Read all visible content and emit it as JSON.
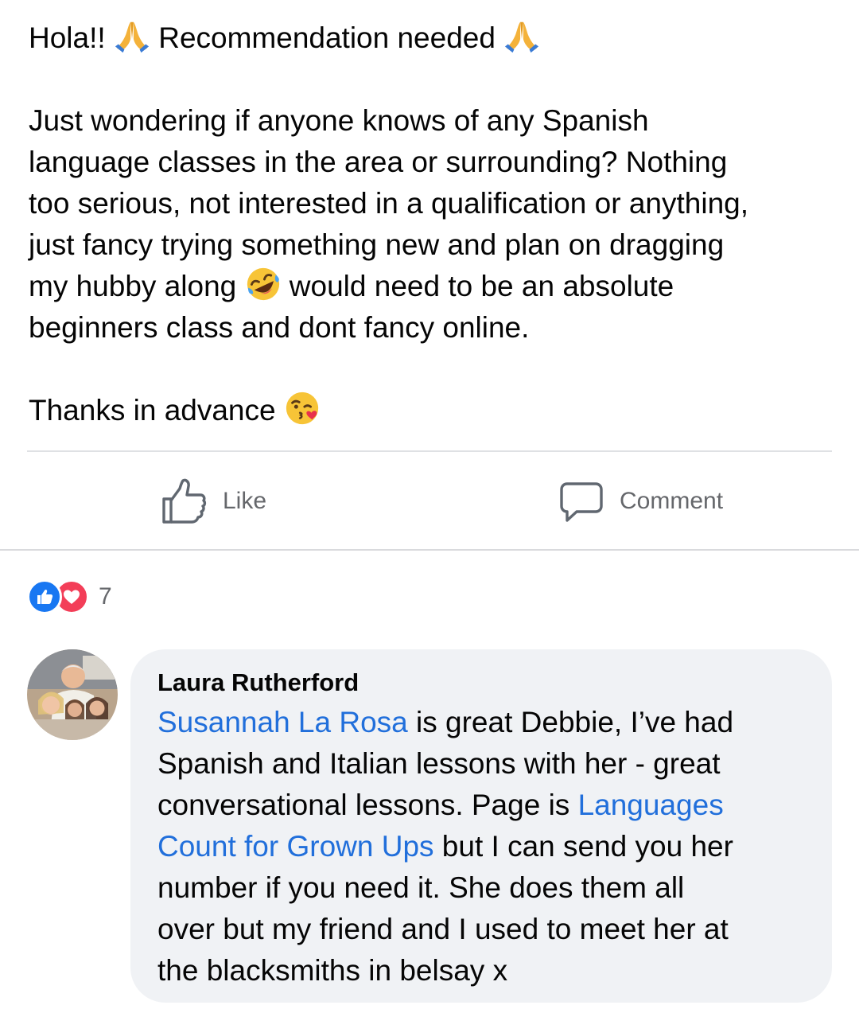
{
  "post": {
    "line1_a": "Hola!!",
    "line1_b": "Recommendation needed",
    "body_line1": "Just wondering if anyone knows of any Spanish",
    "body_line2": "language classes in the area or surrounding?  Nothing",
    "body_line3": "too serious, not interested in a qualification or anything,",
    "body_line4": "just fancy trying something new and plan on dragging",
    "body_line5_a": "my hubby along",
    "body_line5_b": "would need to be an absolute",
    "body_line6": "beginners class and dont fancy online.",
    "thanks": "Thanks in advance",
    "emojis": [
      "folded-hands",
      "folded-hands",
      "rolling-on-floor-laughing",
      "face-blowing-kiss"
    ]
  },
  "actions": {
    "like_label": "Like",
    "comment_label": "Comment"
  },
  "reactions": {
    "icons": [
      "like-reaction",
      "love-reaction"
    ],
    "count": "7",
    "like_color": "#1877f2",
    "love_color": "#f33e58"
  },
  "comment": {
    "author": "Laura Rutherford",
    "mention1": "Susannah La Rosa",
    "text1": " is great Debbie, I’ve had",
    "text2": "Spanish and Italian lessons with her - great",
    "text3": "conversational lessons. Page is ",
    "mention2_a": "Languages",
    "mention2_b": "Count for Grown Ups",
    "text4": " but I can send you her",
    "text5": "number if you need it. She does them all",
    "text6": "over but my friend and I used to meet her at",
    "text7": "the blacksmiths in belsay x",
    "link_color": "#216fdb"
  }
}
